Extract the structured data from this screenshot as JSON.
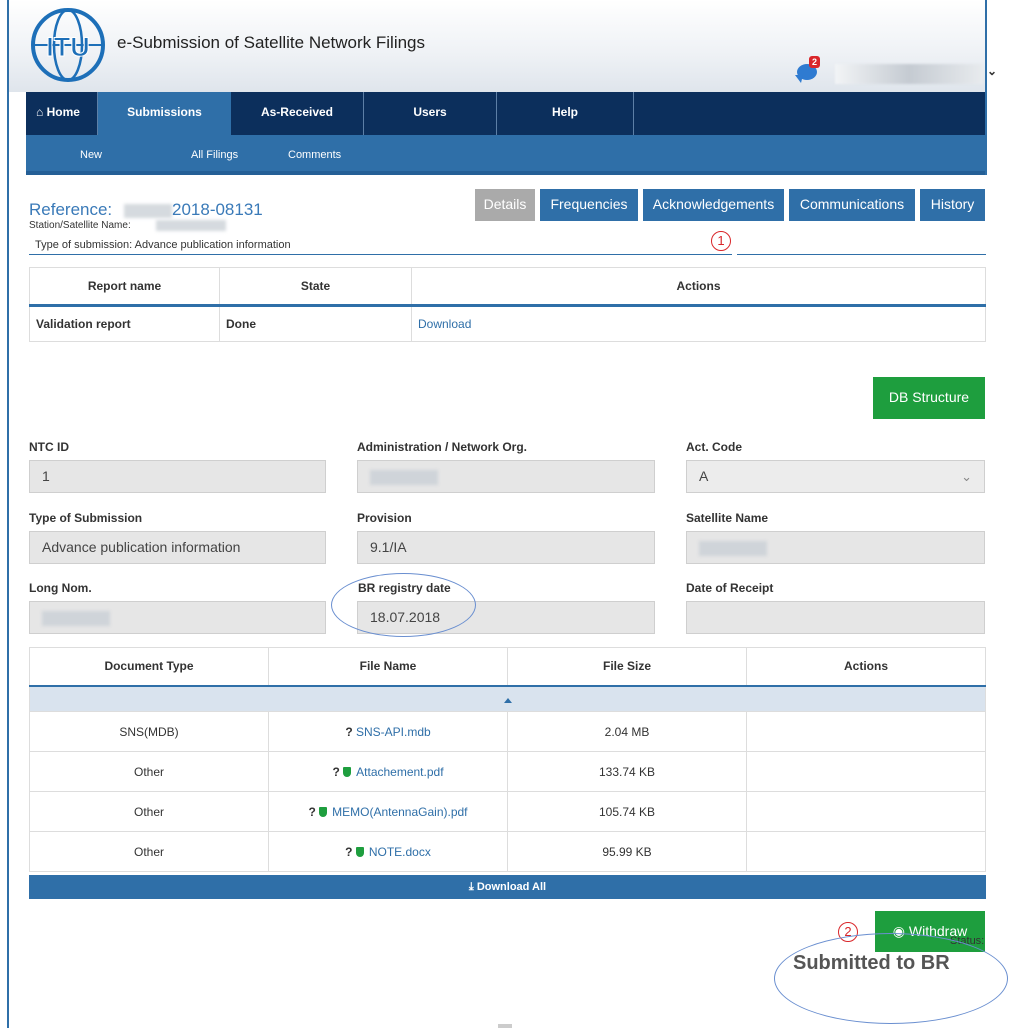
{
  "header": {
    "app_title": "e-Submission of Satellite Network Filings",
    "logo_text": "ITU",
    "notification_count": "2"
  },
  "main_nav": {
    "tabs": [
      {
        "label": "Home",
        "icon": "home-icon"
      },
      {
        "label": "Submissions",
        "active": true
      },
      {
        "label": "As-Received"
      },
      {
        "label": "Users"
      },
      {
        "label": "Help"
      }
    ]
  },
  "sub_nav": {
    "items": [
      "New",
      "All Filings",
      "Comments"
    ]
  },
  "reference": {
    "label": "Reference:",
    "number": "2018-08131",
    "station_label": "Station/Satellite Name:",
    "type_line": "Type of submission: Advance publication information"
  },
  "detail_tabs": [
    "Details",
    "Frequencies",
    "Acknowledgements",
    "Communications",
    "History"
  ],
  "annotations": {
    "marker1": "1",
    "marker2": "2"
  },
  "report_table": {
    "headers": [
      "Report name",
      "State",
      "Actions"
    ],
    "rows": [
      {
        "name": "Validation report",
        "state": "Done",
        "action": "Download"
      }
    ]
  },
  "db_structure_button": "DB Structure",
  "form": {
    "ntc_id": {
      "label": "NTC ID",
      "value": "1"
    },
    "admin": {
      "label": "Administration / Network Org."
    },
    "act_code": {
      "label": "Act. Code",
      "value": "A"
    },
    "type_of_submission": {
      "label": "Type of Submission",
      "value": "Advance publication information"
    },
    "provision": {
      "label": "Provision",
      "value": "9.1/IA"
    },
    "satellite_name": {
      "label": "Satellite Name"
    },
    "long_nom": {
      "label": "Long Nom."
    },
    "br_registry_date": {
      "label": "BR registry date",
      "value": "18.07.2018"
    },
    "date_of_receipt": {
      "label": "Date of Receipt",
      "value": ""
    }
  },
  "documents": {
    "headers": [
      "Document Type",
      "File Name",
      "File Size",
      "Actions"
    ],
    "rows": [
      {
        "type": "SNS(MDB)",
        "file": "SNS-API.mdb",
        "size": "2.04 MB",
        "shield": false
      },
      {
        "type": "Other",
        "file": "Attachement.pdf",
        "size": "133.74 KB",
        "shield": true
      },
      {
        "type": "Other",
        "file": "MEMO(AntennaGain).pdf",
        "size": "105.74 KB",
        "shield": true
      },
      {
        "type": "Other",
        "file": "NOTE.docx",
        "size": "95.99 KB",
        "shield": true
      }
    ],
    "download_all": "Download All"
  },
  "withdraw_button": "Withdraw",
  "status": {
    "label": "Status:",
    "value": "Submitted to BR"
  },
  "colors": {
    "nav_dark": "#0c2f5c",
    "accent": "#2f6fa8",
    "green": "#1e9e3e",
    "marker": "#d9262a"
  }
}
